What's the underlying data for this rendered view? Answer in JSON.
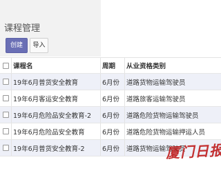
{
  "page": {
    "title": "课程管理"
  },
  "toolbar": {
    "create_label": "创建",
    "import_label": "导入"
  },
  "table": {
    "columns": [
      "课程名",
      "周期",
      "从业资格类别"
    ],
    "rows": [
      {
        "name": "19年6月普货安全教育",
        "period": "6月份",
        "category": "道路货物运输驾驶员"
      },
      {
        "name": "19年6月客运安全教育",
        "period": "6月份",
        "category": "道路旅客运输驾驶员"
      },
      {
        "name": "19年6月危险品安全教育-2",
        "period": "6月份",
        "category": "道路危险货物运输驾驶员"
      },
      {
        "name": "19年6月危险品安全教育",
        "period": "6月份",
        "category": "道路危险货物运输押运人员"
      },
      {
        "name": "19年6月普货安全教育-2",
        "period": "6月份",
        "category": "道路货物运输驾驶员"
      }
    ]
  },
  "watermark": {
    "text": "厦门日报",
    "color": "#be1919"
  }
}
